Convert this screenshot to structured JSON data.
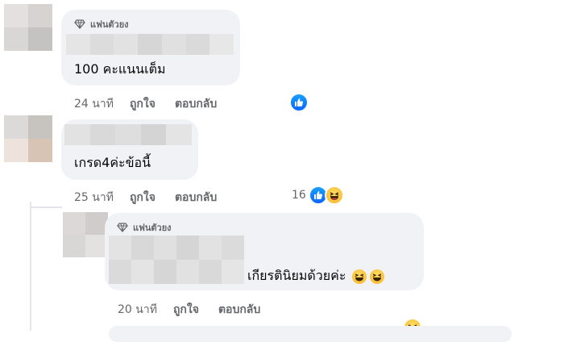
{
  "comments": [
    {
      "badge": "แฟนตัวยง",
      "text": "100 คะแนนเต็ม",
      "time": "24 นาที",
      "like_label": "ถูกใจ",
      "reply_label": "ตอบกลับ"
    },
    {
      "text": "เกรด4ค่ะข้อนี้",
      "time": "25 นาที",
      "like_label": "ถูกใจ",
      "reply_label": "ตอบกลับ",
      "reaction_count": "16"
    },
    {
      "badge": "แฟนตัวยง",
      "text": "เกียรตินิยมด้วยค่ะ",
      "time": "20 นาที",
      "like_label": "ถูกใจ",
      "reply_label": "ตอบกลับ"
    }
  ],
  "colors": {
    "bubble": "#f0f2f5",
    "meta_text": "#65676b",
    "like_blue": "#0866ff",
    "haha_yellow": "#f7b125"
  },
  "icons": [
    "diamond-icon",
    "like-reaction-icon",
    "haha-reaction-icon",
    "rofl-emoji-icon"
  ]
}
